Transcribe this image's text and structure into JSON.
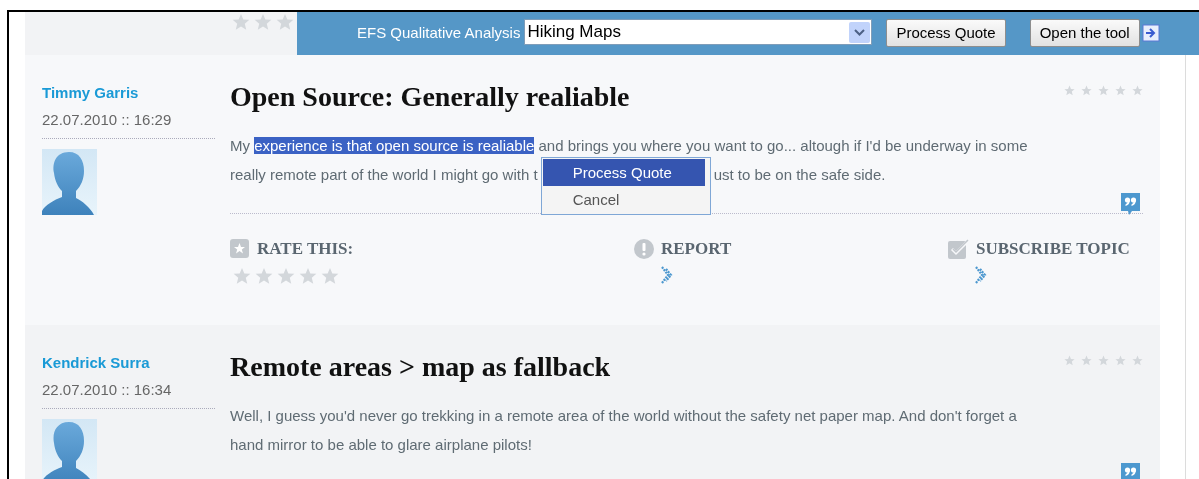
{
  "toolbar": {
    "title": "EFS Qualitative Analysis",
    "analysis_select": {
      "value": "Hiking Maps"
    },
    "buttons": [
      "Process Quote",
      "Open the tool"
    ]
  },
  "top_rating": {
    "stars": 0
  },
  "posts": [
    {
      "author": "Timmy Garris",
      "date": "22.07.2010 :: 16:29",
      "title": "Open Source: Generally realiable",
      "rating": {
        "stars": 0
      },
      "body_lines": [
        [
          {
            "kind": "text",
            "text": "My ",
            "selected": false
          },
          {
            "kind": "text",
            "text": "experience is that open source is realiable",
            "selected": true
          },
          {
            "kind": "text",
            "text": " and brings you where you want to go... altough if I'd be underway in some",
            "selected": false
          }
        ],
        [
          {
            "kind": "text",
            "text": "really remote part of the world I might go with t",
            "selected": false
          },
          {
            "kind": "covered"
          },
          {
            "kind": "text",
            "text": "ust to be on the safe side.",
            "selected": false
          }
        ]
      ],
      "actions": {
        "rate_label": "RATE THIS:",
        "rate": {
          "stars": 0
        },
        "report": "REPORT",
        "subscribe": "SUBSCRIBE TOPIC"
      }
    },
    {
      "author": "Kendrick Surra",
      "date": "22.07.2010 :: 16:34",
      "title": "Remote areas > map as fallback",
      "rating": {
        "stars": 0
      },
      "body_lines": [
        [
          {
            "kind": "text",
            "text": "Well, I guess you'd never go trekking in a remote area of the world without the safety net paper map. And don't forget a",
            "selected": false
          }
        ],
        [
          {
            "kind": "text",
            "text": "hand mirror to be able to glare airplane pilots!",
            "selected": false
          }
        ]
      ]
    }
  ],
  "context_menu": {
    "items": [
      {
        "label": "Process Quote",
        "selected": true
      },
      {
        "label": "Cancel",
        "selected": false
      }
    ]
  }
}
